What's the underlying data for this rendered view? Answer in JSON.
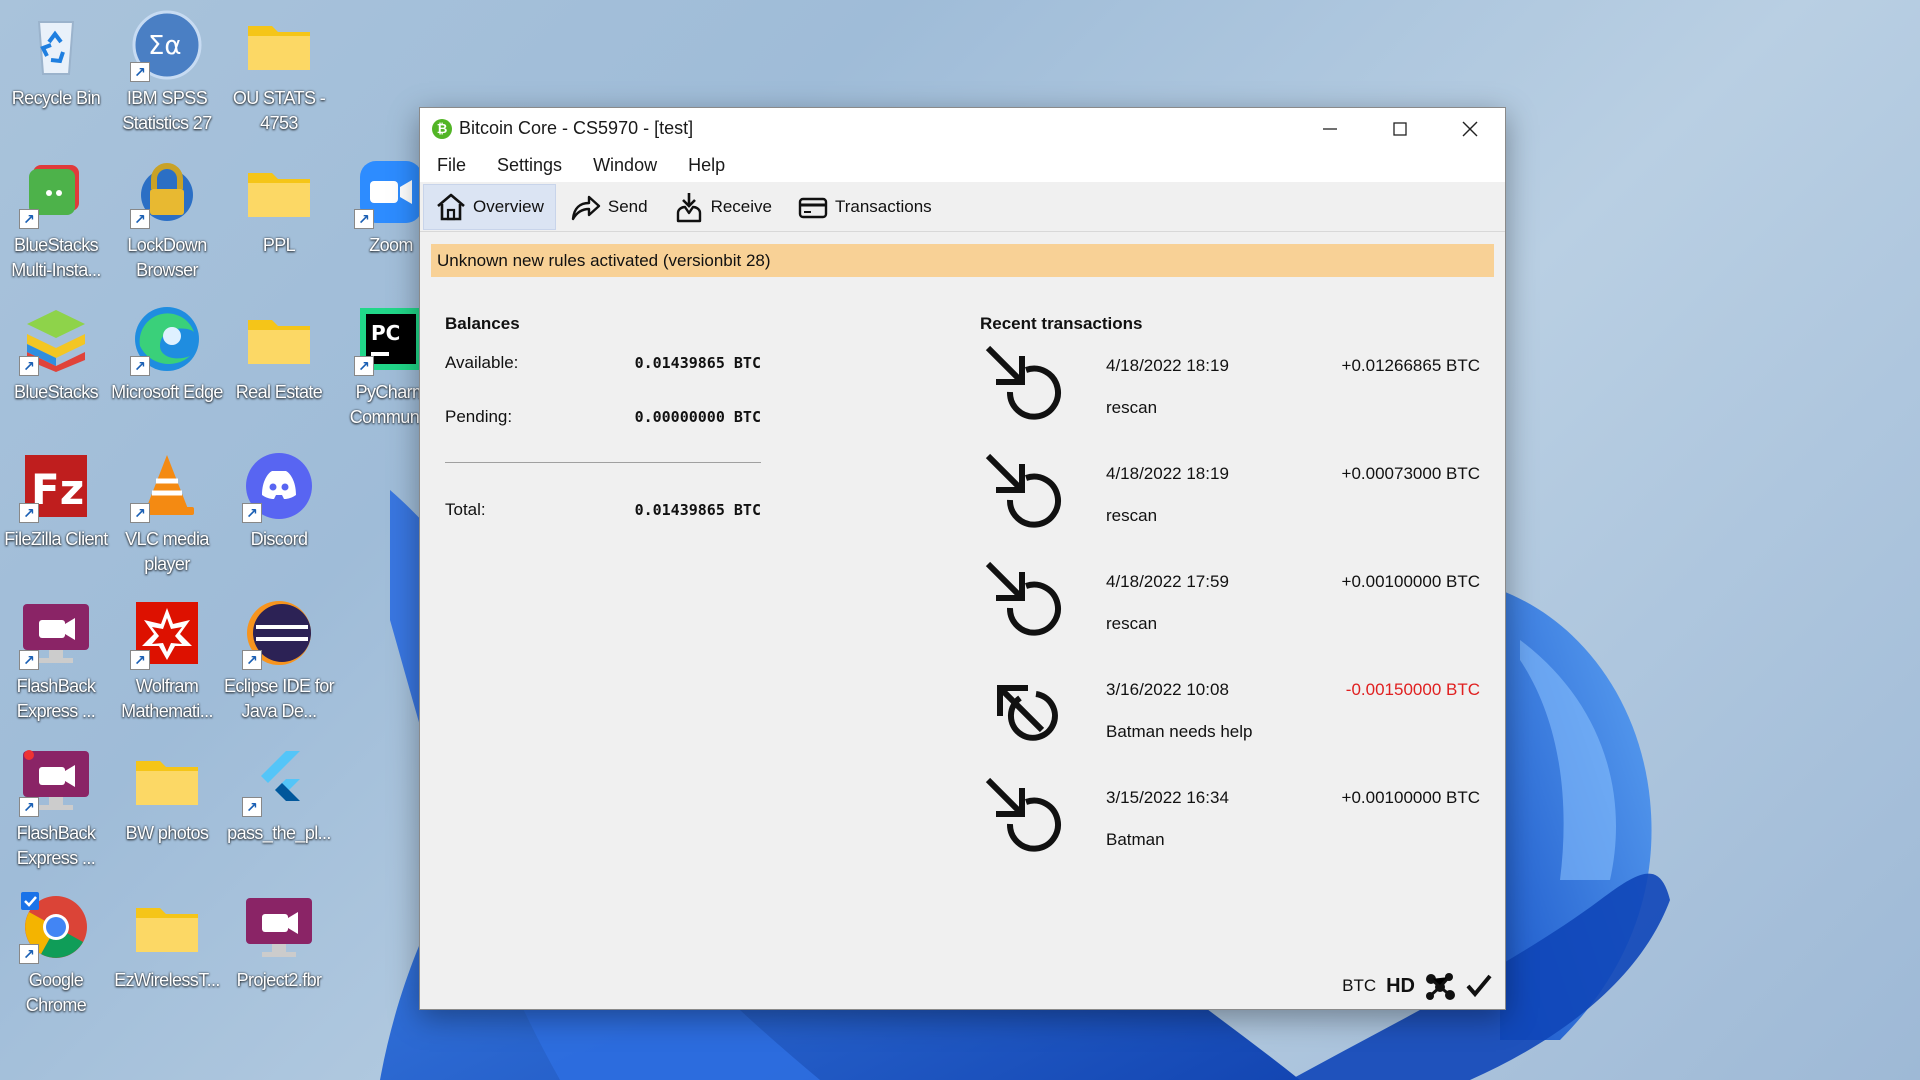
{
  "desktop": {
    "icons": [
      {
        "label": "Recycle Bin",
        "icon": "recycle-bin-icon"
      },
      {
        "label": "IBM SPSS Statistics 27",
        "icon": "spss-icon"
      },
      {
        "label": "OU STATS - 4753",
        "icon": "folder-icon"
      },
      {
        "label": "BlueStacks Multi-Insta...",
        "icon": "bluestacks-multi-icon"
      },
      {
        "label": "LockDown Browser",
        "icon": "lockdown-browser-icon"
      },
      {
        "label": "PPL",
        "icon": "folder-icon"
      },
      {
        "label": "Zoom",
        "icon": "zoom-icon"
      },
      {
        "label": "BlueStacks",
        "icon": "bluestacks-icon"
      },
      {
        "label": "Microsoft Edge",
        "icon": "edge-icon"
      },
      {
        "label": "Real Estate",
        "icon": "folder-icon"
      },
      {
        "label": "PyCharm Commun...",
        "icon": "pycharm-icon"
      },
      {
        "label": "FileZilla Client",
        "icon": "filezilla-icon"
      },
      {
        "label": "VLC media player",
        "icon": "vlc-icon"
      },
      {
        "label": "Discord",
        "icon": "discord-icon"
      },
      {
        "label": "FlashBack Express ...",
        "icon": "flashback-icon"
      },
      {
        "label": "Wolfram Mathemati...",
        "icon": "wolfram-icon"
      },
      {
        "label": "Eclipse IDE for Java De...",
        "icon": "eclipse-icon"
      },
      {
        "label": "FlashBack Express ...",
        "icon": "flashback-icon"
      },
      {
        "label": "BW photos",
        "icon": "folder-icon"
      },
      {
        "label": "pass_the_pl...",
        "icon": "flutter-icon"
      },
      {
        "label": "Google Chrome",
        "icon": "chrome-icon"
      },
      {
        "label": "EzWirelessT...",
        "icon": "folder-icon"
      },
      {
        "label": "Project2.fbr",
        "icon": "flashback-icon"
      }
    ]
  },
  "window": {
    "title": "Bitcoin Core - CS5970 - [test]",
    "app_icon_glyph": "₿",
    "controls": {
      "minimize": "—",
      "maximize": "☐",
      "close": "✕"
    }
  },
  "menu": [
    "File",
    "Settings",
    "Window",
    "Help"
  ],
  "tabs": [
    {
      "label": "Overview",
      "icon": "home-icon",
      "active": true
    },
    {
      "label": "Send",
      "icon": "send-arrow-icon",
      "active": false
    },
    {
      "label": "Receive",
      "icon": "receive-icon",
      "active": false
    },
    {
      "label": "Transactions",
      "icon": "transactions-card-icon",
      "active": false
    }
  ],
  "alert": "Unknown new rules activated (versionbit 28)",
  "balances": {
    "title": "Balances",
    "available_label": "Available:",
    "available_value": "0.01439865 BTC",
    "pending_label": "Pending:",
    "pending_value": "0.00000000 BTC",
    "total_label": "Total:",
    "total_value": "0.01439865 BTC"
  },
  "recent": {
    "title": "Recent transactions",
    "items": [
      {
        "date": "4/18/2022 18:19",
        "amount": "+0.01266865 BTC",
        "label": "rescan",
        "direction": "incoming"
      },
      {
        "date": "4/18/2022 18:19",
        "amount": "+0.00073000 BTC",
        "label": "rescan",
        "direction": "incoming"
      },
      {
        "date": "4/18/2022 17:59",
        "amount": "+0.00100000 BTC",
        "label": "rescan",
        "direction": "incoming"
      },
      {
        "date": "3/16/2022 10:08",
        "amount": "-0.00150000 BTC",
        "label": "Batman needs help",
        "direction": "outgoing"
      },
      {
        "date": "3/15/2022 16:34",
        "amount": "+0.00100000 BTC",
        "label": "Batman",
        "direction": "incoming"
      }
    ]
  },
  "statusbar": {
    "unit": "BTC",
    "hd": "HD"
  },
  "colors": {
    "negative": "#e02020",
    "alert_bg": "#f8d196",
    "active_tab": "#dbe4f3",
    "bitcoin_green": "#52b526"
  }
}
